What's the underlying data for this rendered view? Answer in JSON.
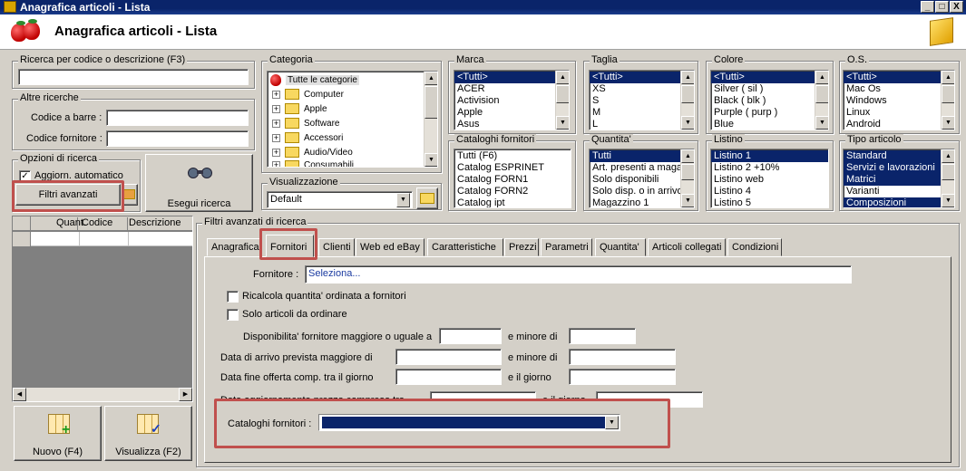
{
  "window": {
    "title": "Anagrafica articoli  - Lista",
    "controls": [
      "_",
      "□",
      "X"
    ]
  },
  "header": {
    "title": "Anagrafica articoli  - Lista"
  },
  "search": {
    "code_desc_label": "Ricerca per codice o descrizione (F3)",
    "code_desc_value": "",
    "other_label": "Altre ricerche",
    "barcode_label": "Codice a barre :",
    "supplier_code_label": "Codice fornitore :"
  },
  "options": {
    "label": "Opzioni di ricerca",
    "auto_update_label": "Aggiorn. automatico",
    "auto_update_checked": true,
    "advanced_filters_button": "Filtri avanzati",
    "search_button": "Esegui ricerca"
  },
  "categoria": {
    "label": "Categoria",
    "root": "Tutte le categorie",
    "items": [
      "Computer",
      "Apple",
      "Software",
      "Accessori",
      "Audio/Video",
      "Consumabili"
    ]
  },
  "visualizzazione": {
    "label": "Visualizzazione",
    "value": "Default"
  },
  "marca": {
    "label": "Marca",
    "items": [
      "<Tutti>",
      "ACER",
      "Activision",
      "Apple",
      "Asus"
    ],
    "selected": 0
  },
  "taglia": {
    "label": "Taglia",
    "items": [
      "<Tutti>",
      "XS",
      "S",
      "M",
      "L"
    ],
    "selected": 0
  },
  "colore": {
    "label": "Colore",
    "items": [
      "<Tutti>",
      "Silver ( sil )",
      "Black ( blk )",
      "Purple ( purp )",
      "Blue"
    ],
    "selected": 0
  },
  "os": {
    "label": "O.S.",
    "items": [
      "<Tutti>",
      "Mac Os",
      "Windows",
      "Linux",
      "Android"
    ],
    "selected": 0
  },
  "cataloghi": {
    "label": "Cataloghi fornitori",
    "items": [
      "Tutti (F6)",
      "Catalog ESPRINET",
      "Catalog FORN1",
      "Catalog FORN2",
      "Catalog ipt"
    ]
  },
  "quantita": {
    "label": "Quantita'",
    "items": [
      "Tutti",
      "Art. presenti a magazzino",
      "Solo disponibili",
      "Solo disp. o in arrivo",
      "Magazzino 1"
    ],
    "selected": 0
  },
  "listino": {
    "label": "Listino",
    "items": [
      "Listino 1",
      "Listino 2 +10%",
      "Listino web",
      "Listino 4",
      "Listino 5"
    ],
    "selected": 0
  },
  "tipo": {
    "label": "Tipo articolo",
    "items": [
      "Standard",
      "Servizi e lavorazioni",
      "Matrici",
      "Varianti",
      "Composizioni"
    ],
    "selected": [
      0,
      1,
      2,
      4
    ]
  },
  "grid": {
    "columns": [
      "Quant.",
      "Codice",
      "Descrizione"
    ]
  },
  "bottom_buttons": {
    "new": "Nuovo (F4)",
    "view": "Visualizza (F2)"
  },
  "advanced": {
    "label": "Filtri avanzati di ricerca",
    "tabs": [
      "Anagrafica",
      "Fornitori",
      "Clienti",
      "Web ed eBay",
      "Caratteristiche",
      "Prezzi",
      "Parametri",
      "Quantita'",
      "Articoli collegati",
      "Condizioni"
    ],
    "active_tab": 1,
    "fornitore_label": "Fornitore :",
    "fornitore_value": "Seleziona...",
    "ricalcola_label": "Ricalcola quantita' ordinata a fornitori",
    "solo_ordinare_label": "Solo articoli da ordinare",
    "disp_label": "Disponibilita' fornitore maggiore o uguale a",
    "minore_di": "e minore di",
    "arrivo_label": "Data di arrivo prevista maggiore di",
    "fine_offerta_label": "Data fine offerta comp. tra il giorno",
    "e_il_giorno": "e il giorno",
    "aggiornamento_label": "Data aggiornamento prezzo compreso tra",
    "cataloghi_label": "Cataloghi fornitori :",
    "cataloghi_value": ""
  },
  "colors": {
    "titlebar": "#0a246a",
    "selection": "#0a246a",
    "highlight_box": "#c0504d",
    "face": "#d4d0c8"
  }
}
